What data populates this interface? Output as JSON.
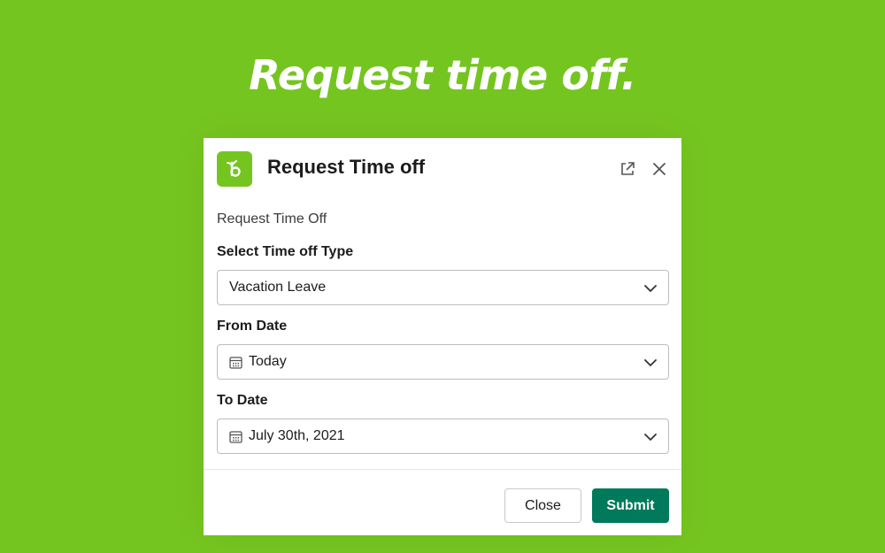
{
  "headline": "Request time off.",
  "modal": {
    "title": "Request Time off",
    "app_icon": "bamboohr-logo-icon",
    "header_icons": [
      "external-link-icon",
      "close-icon"
    ],
    "section_text": "Request Time Off",
    "fields": [
      {
        "label": "Select Time off Type",
        "value": "Vacation Leave",
        "icon": ""
      },
      {
        "label": "From Date",
        "value": "Today",
        "icon": "calendar-icon"
      },
      {
        "label": "To Date",
        "value": "July 30th, 2021",
        "icon": "calendar-icon"
      }
    ],
    "buttons": {
      "close_label": "Close",
      "submit_label": "Submit"
    }
  },
  "colors": {
    "background": "#75c520",
    "submit": "#007a5a",
    "logo": "#75c520"
  }
}
